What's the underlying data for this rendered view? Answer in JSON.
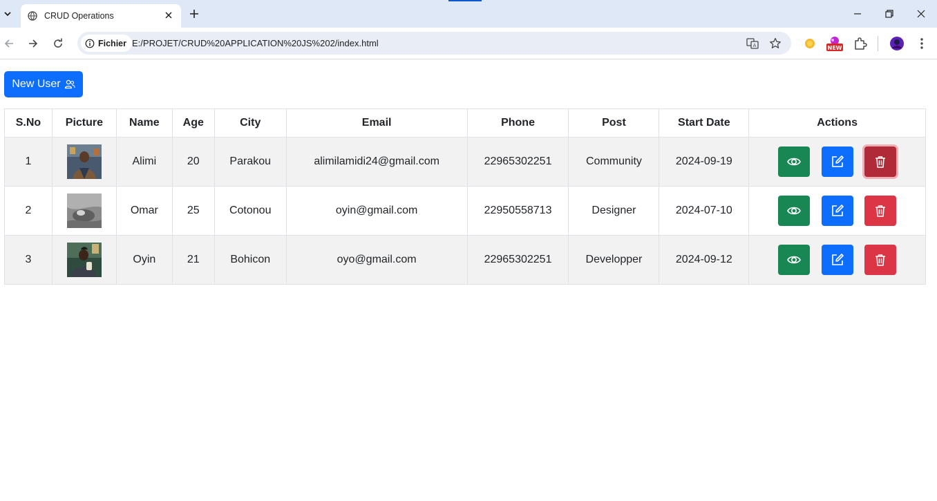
{
  "browser": {
    "tab_title": "CRUD Operations",
    "security_chip": "Fichier",
    "url": "E:/PROJET/CRUD%20APPLICATION%20JS%202/index.html",
    "new_badge": "NEW"
  },
  "page": {
    "new_user_label": "New User",
    "columns": [
      "S.No",
      "Picture",
      "Name",
      "Age",
      "City",
      "Email",
      "Phone",
      "Post",
      "Start Date",
      "Actions"
    ],
    "rows": [
      {
        "sno": "1",
        "name": "Alimi",
        "age": "20",
        "city": "Parakou",
        "email": "alimilamidi24@gmail.com",
        "phone": "22965302251",
        "post": "Community",
        "start": "2024-09-19"
      },
      {
        "sno": "2",
        "name": "Omar",
        "age": "25",
        "city": "Cotonou",
        "email": "oyin@gmail.com",
        "phone": "22950558713",
        "post": "Designer",
        "start": "2024-07-10"
      },
      {
        "sno": "3",
        "name": "Oyin",
        "age": "21",
        "city": "Bohicon",
        "email": "oyo@gmail.com",
        "phone": "22965302251",
        "post": "Developper",
        "start": "2024-09-12"
      }
    ]
  },
  "colors": {
    "primary": "#0d6efd",
    "success": "#198754",
    "danger": "#dc3545",
    "tabstrip": "#dfe8f7"
  },
  "icons": [
    "globe-icon",
    "close-icon",
    "plus-icon",
    "minimize-icon",
    "restore-icon",
    "back-icon",
    "forward-icon",
    "reload-icon",
    "info-icon",
    "translate-icon",
    "star-icon",
    "extensions-icon",
    "profile-avatar",
    "menu-icon",
    "users-icon",
    "eye-icon",
    "edit-icon",
    "trash-icon"
  ]
}
